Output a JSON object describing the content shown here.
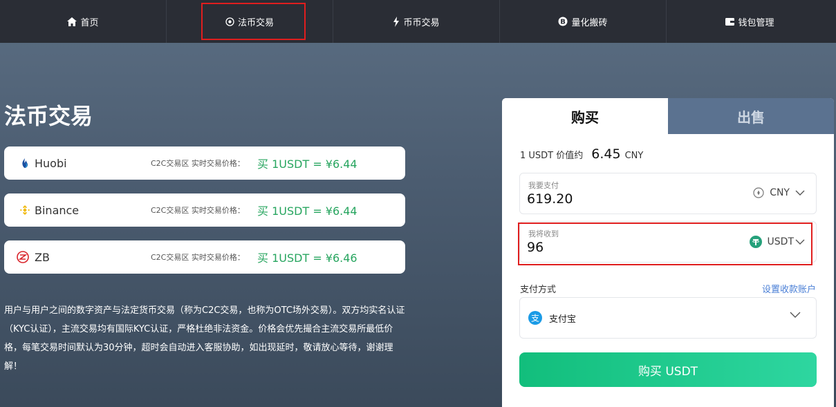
{
  "nav": {
    "items": [
      {
        "label": "首页",
        "icon": "home-icon"
      },
      {
        "label": "法币交易",
        "icon": "target-icon",
        "active": true
      },
      {
        "label": "币币交易",
        "icon": "lightning-icon"
      },
      {
        "label": "量化搬砖",
        "icon": "bitcoin-icon"
      },
      {
        "label": "钱包管理",
        "icon": "wallet-icon"
      }
    ]
  },
  "page_title": "法币交易",
  "exchanges": [
    {
      "name": "Huobi",
      "meta": "C2C交易区 实时交易价格：",
      "price": "买 1USDT = ¥6.44",
      "icon": "huobi-logo-icon"
    },
    {
      "name": "Binance",
      "meta": "C2C交易区 实时交易价格：",
      "price": "买 1USDT = ¥6.44",
      "icon": "binance-logo-icon"
    },
    {
      "name": "ZB",
      "meta": "C2C交易区 实时交易价格：",
      "price": "买 1USDT = ¥6.46",
      "icon": "zb-logo-icon"
    }
  ],
  "description": "用户与用户之间的数字资产与法定货币交易（称为C2C交易，也称为OTC场外交易）。双方均实名认证（KYC认证），主流交易均有国际KYC认证，严格杜绝非法资金。价格会优先撮合主流交易所最低价格，每笔交易时间默认为30分钟，超时会自动进入客服协助，如出现延时，敬请放心等待，谢谢理解！",
  "panel": {
    "tab_buy": "购买",
    "tab_sell": "出售",
    "rate_prefix": "1 USDT 价值约",
    "rate_value": "6.45",
    "rate_unit": "CNY",
    "pay_field": {
      "label": "我要支付",
      "value": "619.20",
      "currency": "CNY"
    },
    "receive_field": {
      "label": "我将收到",
      "value": "96",
      "currency": "USDT"
    },
    "payment_label": "支付方式",
    "payment_link": "设置收款账户",
    "payment_method": "支付宝",
    "buy_button": "购买 USDT"
  },
  "colors": {
    "nav_bg": "#2a2d35",
    "price_green": "#27a55f",
    "sell_tab": "#5b7290",
    "link_blue": "#4a7fd6",
    "button_green": "#12be7c",
    "highlight_red": "#e01e1e"
  }
}
